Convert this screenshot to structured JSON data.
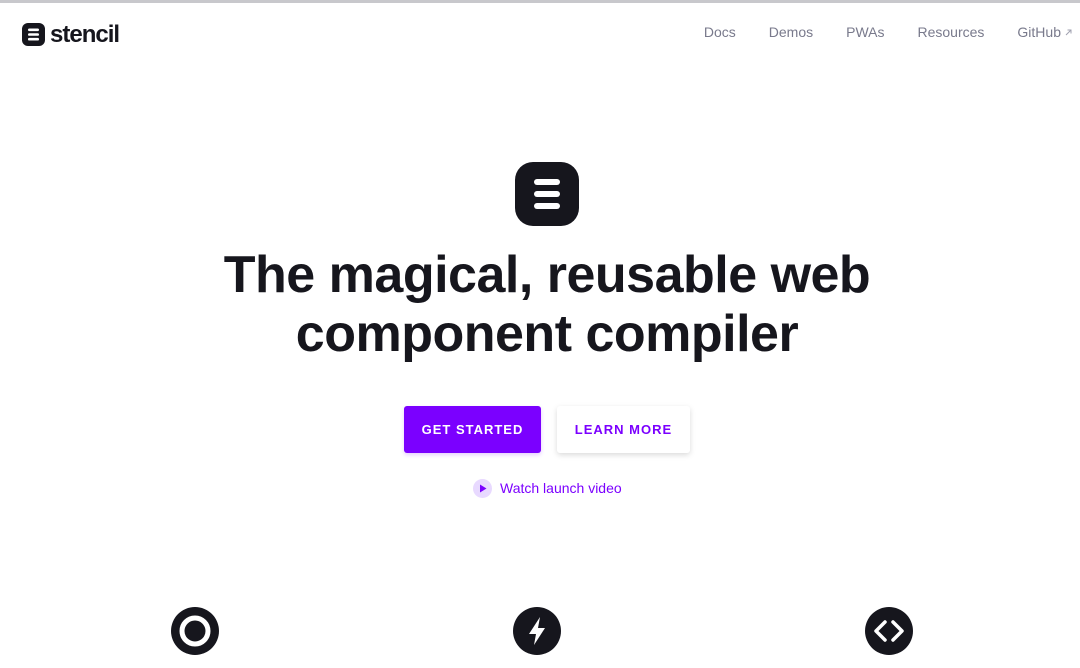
{
  "header": {
    "logo_text": "stencil",
    "nav": [
      {
        "label": "Docs"
      },
      {
        "label": "Demos"
      },
      {
        "label": "PWAs"
      },
      {
        "label": "Resources"
      },
      {
        "label": "GitHub",
        "external": true
      }
    ]
  },
  "hero": {
    "title": "The magical, reusable web component compiler",
    "primary_button": "GET STARTED",
    "secondary_button": "LEARN MORE",
    "video_link": "Watch launch video"
  },
  "features": {
    "icons": [
      "ring-icon",
      "lightning-icon",
      "code-brackets-icon"
    ]
  },
  "colors": {
    "brand": "#7b00ff",
    "dark": "#16161d",
    "nav_text": "#797a8c"
  }
}
